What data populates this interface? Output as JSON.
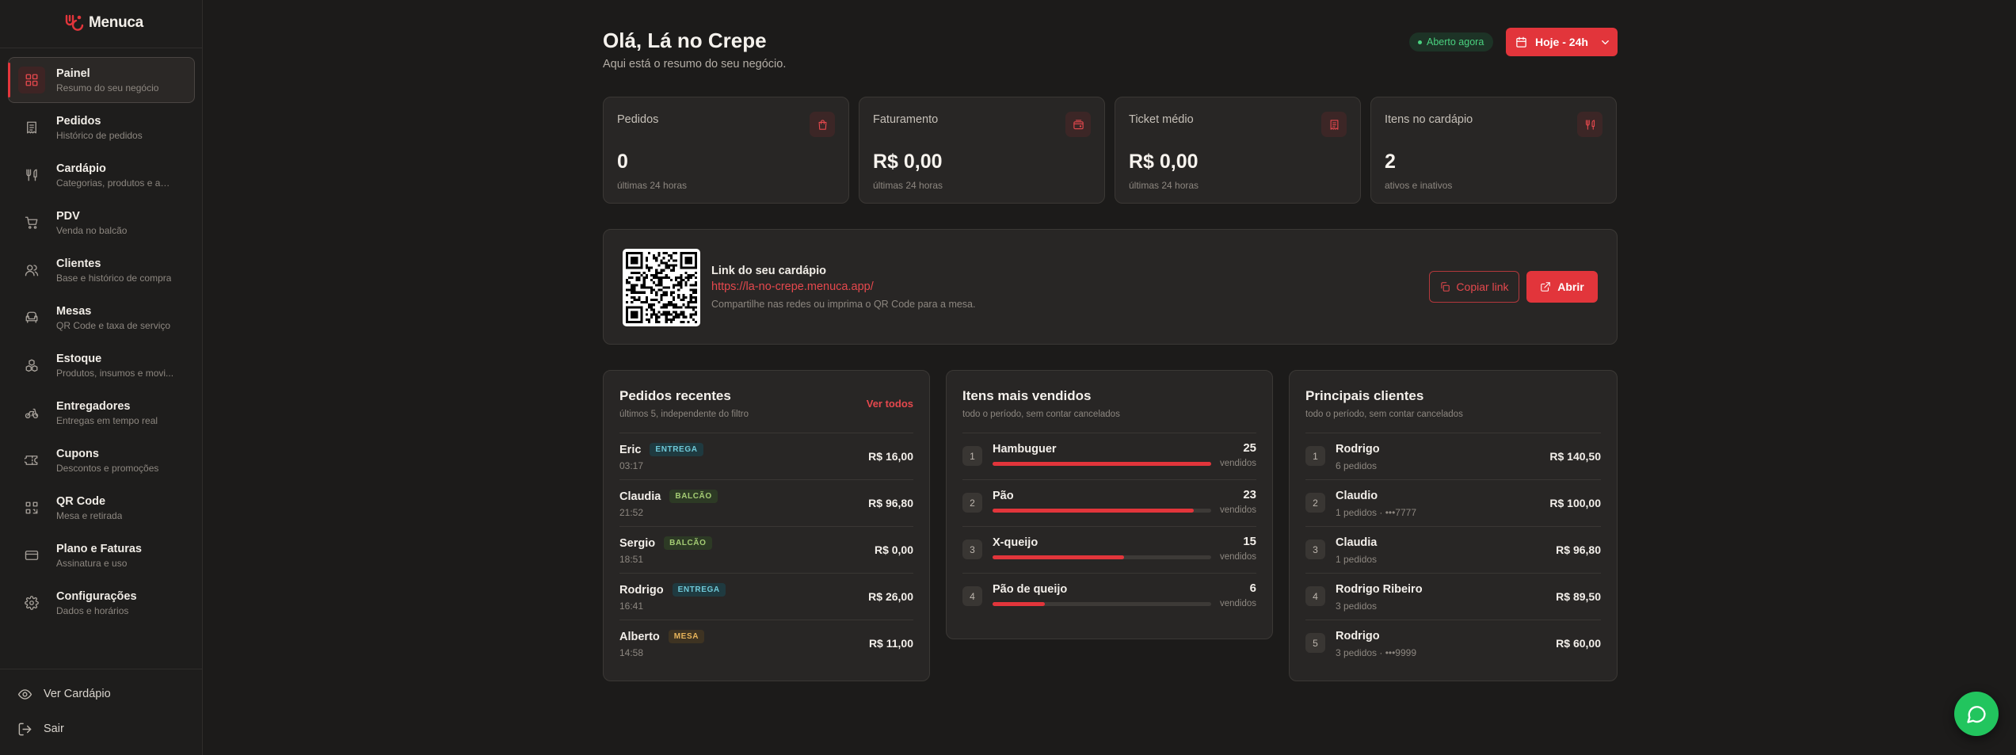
{
  "brand": {
    "name": "Menuca",
    "accent": "#e2353b",
    "success": "#22c55e"
  },
  "sidebar": {
    "items": [
      {
        "title": "Painel",
        "sub": "Resumo do seu negócio",
        "icon": "dashboard-icon",
        "active": true
      },
      {
        "title": "Pedidos",
        "sub": "Histórico de pedidos",
        "icon": "receipt-icon"
      },
      {
        "title": "Cardápio",
        "sub": "Categorias, produtos e adi...",
        "icon": "utensils-icon"
      },
      {
        "title": "PDV",
        "sub": "Venda no balcão",
        "icon": "cart-icon"
      },
      {
        "title": "Clientes",
        "sub": "Base e histórico de compra",
        "icon": "users-icon"
      },
      {
        "title": "Mesas",
        "sub": "QR Code e taxa de serviço",
        "icon": "armchair-icon"
      },
      {
        "title": "Estoque",
        "sub": "Produtos, insumos e movi...",
        "icon": "boxes-icon"
      },
      {
        "title": "Entregadores",
        "sub": "Entregas em tempo real",
        "icon": "bike-icon"
      },
      {
        "title": "Cupons",
        "sub": "Descontos e promoções",
        "icon": "ticket-icon"
      },
      {
        "title": "QR Code",
        "sub": "Mesa e retirada",
        "icon": "qrcode-icon"
      },
      {
        "title": "Plano e Faturas",
        "sub": "Assinatura e uso",
        "icon": "credit-card-icon"
      },
      {
        "title": "Configurações",
        "sub": "Dados e horários",
        "icon": "gear-icon"
      }
    ],
    "view_menu": "Ver Cardápio",
    "logout": "Sair"
  },
  "header": {
    "greeting": "Olá, Lá no Crepe",
    "subtitle": "Aqui está o resumo do seu negócio.",
    "status": "Aberto agora",
    "period": "Hoje - 24h"
  },
  "stats": [
    {
      "label": "Pedidos",
      "value": "0",
      "foot": "últimas 24 horas",
      "icon": "bag-icon"
    },
    {
      "label": "Faturamento",
      "value": "R$ 0,00",
      "foot": "últimas 24 horas",
      "icon": "wallet-icon"
    },
    {
      "label": "Ticket médio",
      "value": "R$ 0,00",
      "foot": "últimas 24 horas",
      "icon": "receipt-icon"
    },
    {
      "label": "Itens no cardápio",
      "value": "2",
      "foot": "ativos e inativos",
      "icon": "utensils-icon"
    }
  ],
  "menu_link": {
    "title": "Link do seu cardápio",
    "url": "https://la-no-crepe.menuca.app/",
    "hint": "Compartilhe nas redes ou imprima o QR Code para a mesa.",
    "copy_label": "Copiar link",
    "open_label": "Abrir"
  },
  "recent_orders": {
    "title": "Pedidos recentes",
    "sub": "últimos 5, independente do filtro",
    "see_all": "Ver todos",
    "rows": [
      {
        "name": "Eric",
        "tag": "ENTREGA",
        "kind": "entrega",
        "time": "03:17",
        "value": "R$ 16,00"
      },
      {
        "name": "Claudia",
        "tag": "BALCÃO",
        "kind": "balcao",
        "time": "21:52",
        "value": "R$ 96,80"
      },
      {
        "name": "Sergio",
        "tag": "BALCÃO",
        "kind": "balcao",
        "time": "18:51",
        "value": "R$ 0,00"
      },
      {
        "name": "Rodrigo",
        "tag": "ENTREGA",
        "kind": "entrega",
        "time": "16:41",
        "value": "R$ 26,00"
      },
      {
        "name": "Alberto",
        "tag": "MESA",
        "kind": "mesa",
        "time": "14:58",
        "value": "R$ 11,00"
      }
    ]
  },
  "top_items": {
    "title": "Itens mais vendidos",
    "sub": "todo o período, sem contar cancelados",
    "unit": "vendidos",
    "rows": [
      {
        "rank": "1",
        "name": "Hambuguer",
        "count": "25",
        "share": 1.0
      },
      {
        "rank": "2",
        "name": "Pão",
        "count": "23",
        "share": 0.92
      },
      {
        "rank": "3",
        "name": "X-queijo",
        "count": "15",
        "share": 0.6
      },
      {
        "rank": "4",
        "name": "Pão de queijo",
        "count": "6",
        "share": 0.24
      }
    ]
  },
  "top_clients": {
    "title": "Principais clientes",
    "sub": "todo o período, sem contar cancelados",
    "rows": [
      {
        "rank": "1",
        "name": "Rodrigo",
        "sub": "6 pedidos",
        "value": "R$ 140,50"
      },
      {
        "rank": "2",
        "name": "Claudio",
        "sub": "1 pedidos · •••7777",
        "value": "R$ 100,00"
      },
      {
        "rank": "3",
        "name": "Claudia",
        "sub": "1 pedidos",
        "value": "R$ 96,80"
      },
      {
        "rank": "4",
        "name": "Rodrigo Ribeiro",
        "sub": "3 pedidos",
        "value": "R$ 89,50"
      },
      {
        "rank": "5",
        "name": "Rodrigo",
        "sub": "3 pedidos · •••9999",
        "value": "R$ 60,00"
      }
    ]
  }
}
